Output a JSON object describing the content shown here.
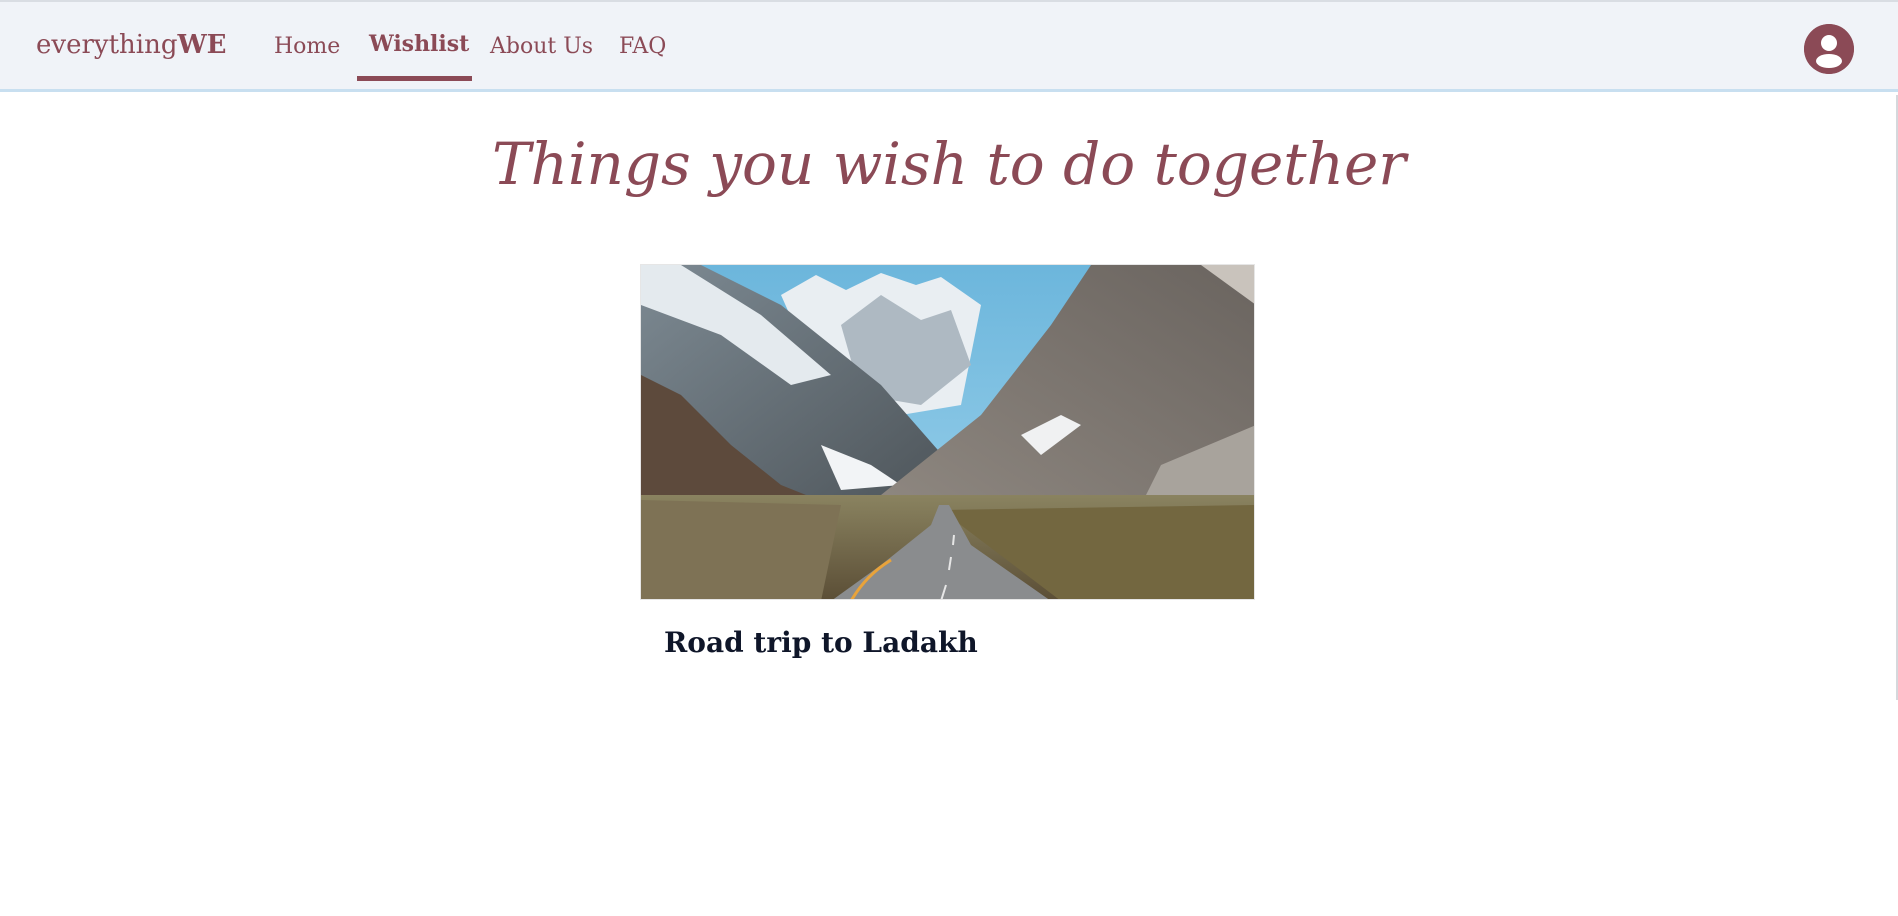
{
  "brand": {
    "prefix": "everything",
    "suffix": "WE"
  },
  "nav": {
    "home": "Home",
    "wishlist": "Wishlist",
    "about": "About Us",
    "faq": "FAQ",
    "active": "Wishlist"
  },
  "account": {
    "icon": "user-avatar-icon"
  },
  "page": {
    "title": "Things you wish to do together"
  },
  "wishlist": {
    "items": [
      {
        "title": "Road trip to Ladakh",
        "image": "mountain-road-photo"
      }
    ]
  },
  "colors": {
    "accent": "#8b4a56",
    "navbar_bg": "#f0f3f8",
    "title_text": "#0f1629"
  }
}
